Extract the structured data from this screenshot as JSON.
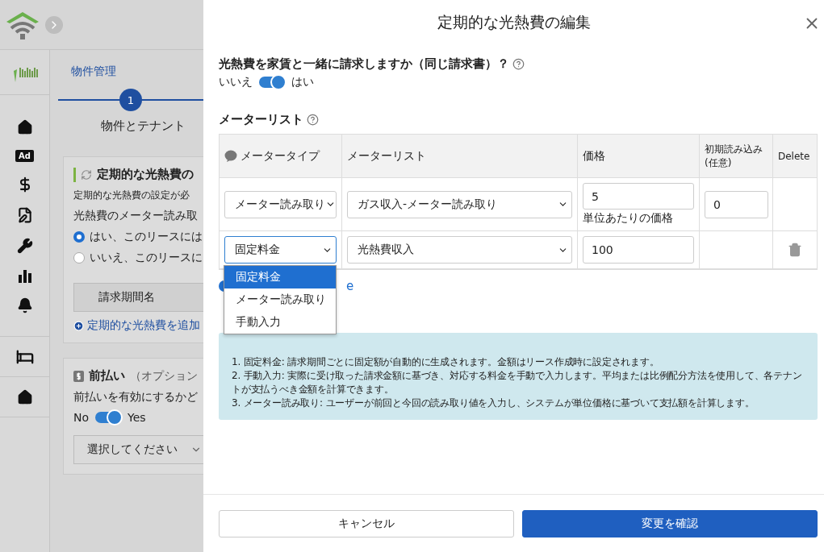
{
  "background": {
    "ad_label": "Ad",
    "breadcrumb": "物件管理",
    "step": {
      "number": "1",
      "label": "物件とテナント"
    },
    "utility_card": {
      "title": "定期的な光熱費の",
      "description": "定期的な光熱費の設定が必",
      "question": "光熱費のメーター読み取",
      "options": [
        {
          "label": "はい、このリースには",
          "selected": true
        },
        {
          "label": "いいえ、このリースに",
          "selected": false
        }
      ],
      "table_header": "請求期間名",
      "add_link": "定期的な光熱費を追加"
    },
    "prepayment_card": {
      "title": "前払い",
      "subtitle": "（オプション",
      "question": "前払いを有効にするかど",
      "toggle": {
        "off_label": "No",
        "on_label": "Yes",
        "on": true
      },
      "select_placeholder": "選択してください"
    }
  },
  "dialog": {
    "title": "定期的な光熱費の編集",
    "question": "光熱費を家賃と一緒に請求しますか（同じ請求書）？",
    "toggle": {
      "off_label": "いいえ",
      "on_label": "はい",
      "on": true
    },
    "meter_list": {
      "title": "メーターリスト",
      "columns": [
        "メータータイプ",
        "メーターリスト",
        "価格",
        "初期読み込み (任意)",
        "Delete"
      ],
      "rows": [
        {
          "meter_type": "メーター読み取り",
          "meter": "ガス収入-メーター読み取り",
          "price": "5",
          "price_hint": "単位あたりの価格",
          "initial_reading": "0",
          "focused": false,
          "deletable": false
        },
        {
          "meter_type": "固定料金",
          "meter": "光熱費収入",
          "price": "100",
          "focused": true,
          "deletable": true
        }
      ]
    },
    "dropdown": {
      "options": [
        {
          "label": "固定料金",
          "selected": true
        },
        {
          "label": "メーター読み取り",
          "selected": false
        },
        {
          "label": "手動入力",
          "selected": false
        }
      ]
    },
    "add_link": "e",
    "info": [
      "1. 固定料金: 請求期間ごとに固定額が自動的に生成されます。金額はリース作成時に設定されます。",
      "2. 手動入力: 実際に受け取った請求金額に基づき、対応する料金を手動で入力します。平均または比例配分方法を使用して、各テナントが支払うべき金額を計算できます。",
      "3. メーター読み取り: ユーザーが前回と今回の読み取り値を入力し、システムが単位価格に基づいて支払額を計算します。"
    ],
    "buttons": {
      "cancel": "キャンセル",
      "confirm": "変更を確認"
    }
  }
}
